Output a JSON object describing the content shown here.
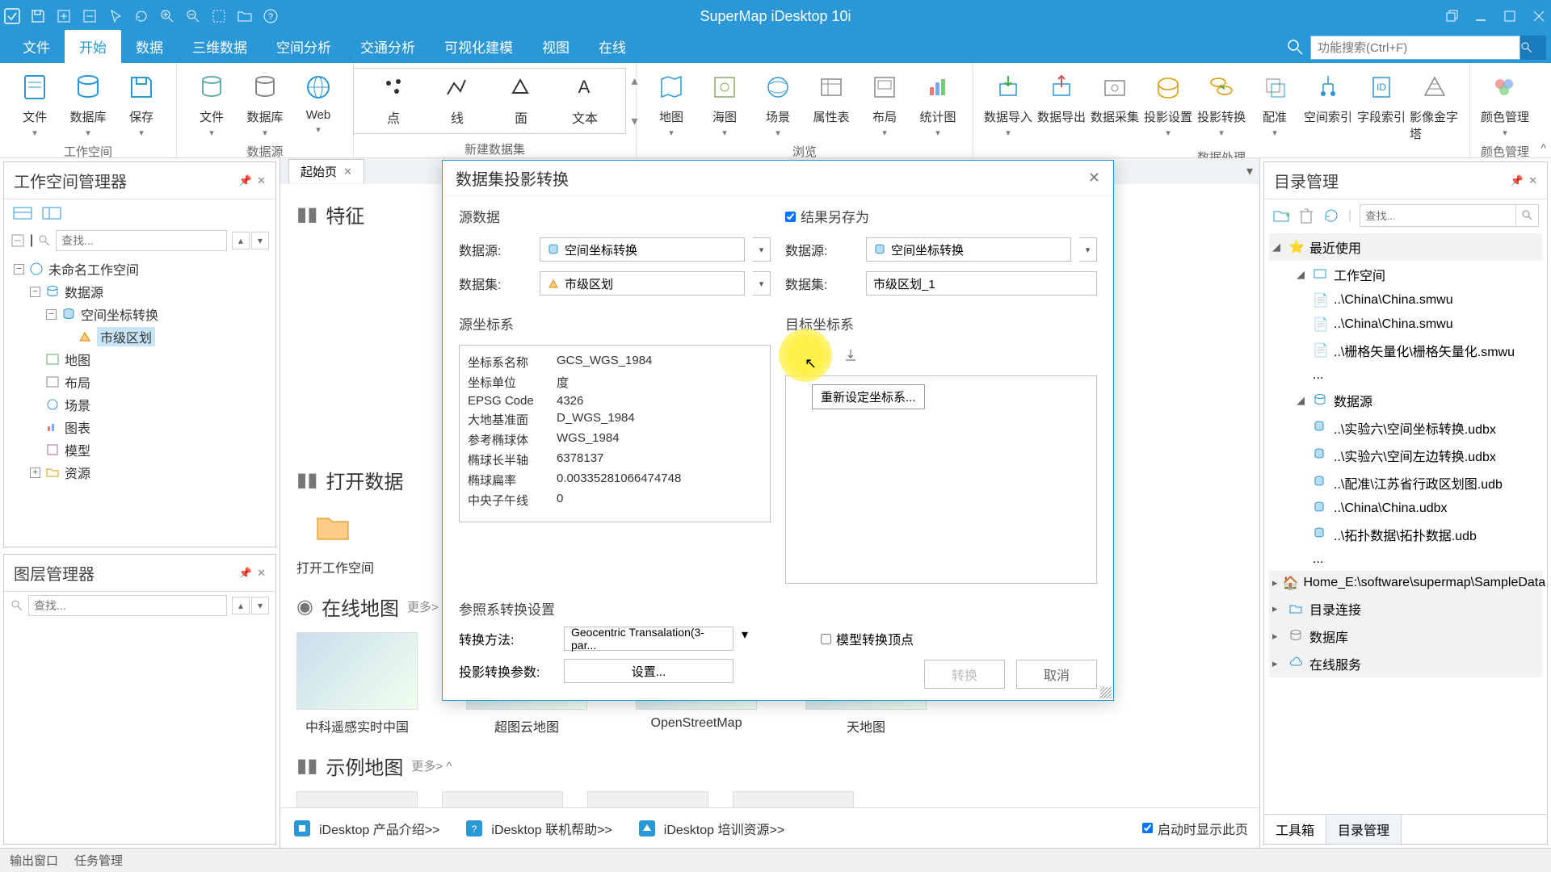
{
  "app_title": "SuperMap iDesktop 10i",
  "menu_tabs": [
    "文件",
    "开始",
    "数据",
    "三维数据",
    "空间分析",
    "交通分析",
    "可视化建模",
    "视图",
    "在线"
  ],
  "active_menu": 1,
  "search_placeholder": "功能搜索(Ctrl+F)",
  "ribbon": {
    "groups": [
      {
        "label": "工作空间",
        "items": [
          {
            "l": "文件"
          },
          {
            "l": "数据库"
          },
          {
            "l": "保存"
          }
        ]
      },
      {
        "label": "数据源",
        "items": [
          {
            "l": "文件"
          },
          {
            "l": "数据库"
          },
          {
            "l": "Web"
          }
        ]
      },
      {
        "label": "新建数据集",
        "newds": true,
        "items": [
          {
            "l": "点"
          },
          {
            "l": "线"
          },
          {
            "l": "面"
          },
          {
            "l": "文本"
          }
        ]
      },
      {
        "label": "浏览",
        "items": [
          {
            "l": "地图"
          },
          {
            "l": "海图"
          },
          {
            "l": "场景"
          },
          {
            "l": "属性表"
          },
          {
            "l": "布局"
          },
          {
            "l": "统计图"
          }
        ]
      },
      {
        "label": "数据处理",
        "items": [
          {
            "l": "数据导入"
          },
          {
            "l": "数据导出"
          },
          {
            "l": "数据采集"
          },
          {
            "l": "投影设置"
          },
          {
            "l": "投影转换"
          },
          {
            "l": "配准"
          },
          {
            "l": "空间索引"
          },
          {
            "l": "字段索引"
          },
          {
            "l": "影像金字塔"
          }
        ]
      },
      {
        "label": "颜色管理",
        "items": [
          {
            "l": "颜色管理"
          }
        ]
      }
    ]
  },
  "left": {
    "workspace_mgr": "工作空间管理器",
    "layer_mgr": "图层管理器",
    "search_ph": "查找...",
    "tree": {
      "root": "未命名工作空间",
      "children": [
        {
          "l": "数据源",
          "open": true,
          "children": [
            {
              "l": "空间坐标转换",
              "open": true,
              "children": [
                {
                  "l": "市级区划",
                  "sel": true
                }
              ]
            }
          ]
        },
        {
          "l": "地图"
        },
        {
          "l": "布局"
        },
        {
          "l": "场景"
        },
        {
          "l": "图表"
        },
        {
          "l": "模型"
        },
        {
          "l": "资源"
        }
      ]
    }
  },
  "doc_tab": "起始页",
  "start": {
    "feature": "特征",
    "open_data": "打开数据",
    "open_ws": "打开工作空间",
    "online_map": "在线地图",
    "sample_map": "示例地图",
    "more": "更多>",
    "maps": [
      "中科遥感实时中国",
      "超图云地图",
      "OpenStreetMap",
      "天地图"
    ]
  },
  "bottom_links": {
    "a": "iDesktop 产品介绍>>",
    "b": "iDesktop 联机帮助>>",
    "c": "iDesktop 培训资源>>",
    "chk": "启动时显示此页"
  },
  "right": {
    "title": "目录管理",
    "search_ph": "查找...",
    "recent": "最近使用",
    "workspace": "工作空间",
    "ws_files": [
      "..\\China\\China.smwu",
      "..\\China\\China.smwu",
      "..\\栅格矢量化\\栅格矢量化.smwu",
      "..."
    ],
    "datasource": "数据源",
    "ds_files": [
      "..\\实验六\\空间坐标转换.udbx",
      "..\\实验六\\空间左边转换.udbx",
      "..\\配准\\江苏省行政区划图.udb",
      "..\\China\\China.udbx",
      "..\\拓扑数据\\拓扑数据.udb",
      "..."
    ],
    "home": "Home_E:\\software\\supermap\\SampleData",
    "catalog_conn": "目录连接",
    "db": "数据库",
    "online": "在线服务",
    "tabs": [
      "工具箱",
      "目录管理"
    ]
  },
  "dialog": {
    "title": "数据集投影转换",
    "src_data": "源数据",
    "datasource_l": "数据源:",
    "dataset_l": "数据集:",
    "src_ds_v": "空间坐标转换",
    "src_dt_v": "市级区划",
    "save_result": "结果另存为",
    "tgt_ds_v": "空间坐标转换",
    "tgt_dt_v": "市级区划_1",
    "src_crs": "源坐标系",
    "tgt_crs": "目标坐标系",
    "crs_rows": [
      {
        "k": "坐标系名称",
        "v": "GCS_WGS_1984"
      },
      {
        "k": "坐标单位",
        "v": "度"
      },
      {
        "k": "EPSG Code",
        "v": "4326"
      },
      {
        "k": "大地基准面",
        "v": "D_WGS_1984"
      },
      {
        "k": "参考椭球体",
        "v": "WGS_1984"
      },
      {
        "k": "椭球长半轴",
        "v": "6378137"
      },
      {
        "k": "椭球扁率",
        "v": "0.00335281066474748"
      },
      {
        "k": "中央子午线",
        "v": "0"
      }
    ],
    "tooltip": "重新设定坐标系...",
    "ref_settings": "参照系转换设置",
    "method_l": "转换方法:",
    "method_v": "Geocentric Transalation(3-par...",
    "params_l": "投影转换参数:",
    "setbtn": "设置...",
    "model_vtx": "模型转换顶点",
    "btn_convert": "转换",
    "btn_cancel": "取消"
  },
  "status": {
    "a": "输出窗口",
    "b": "任务管理"
  }
}
